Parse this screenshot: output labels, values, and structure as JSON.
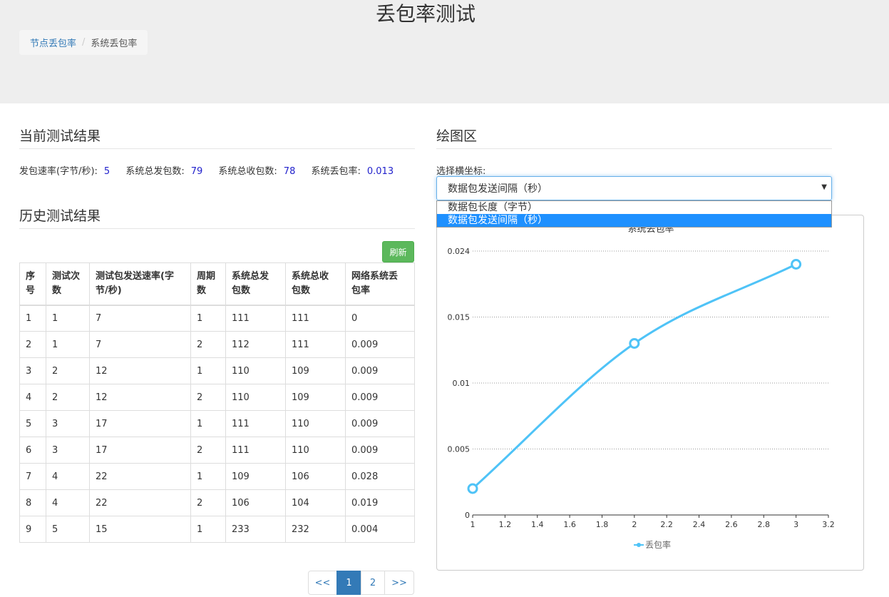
{
  "header": {
    "title": "丢包率测试",
    "breadcrumb": {
      "link": "节点丢包率",
      "separator": "/",
      "current": "系统丢包率"
    }
  },
  "current": {
    "heading": "当前测试结果",
    "rate_label": "发包速率(字节/秒):",
    "rate_value": "5",
    "sent_label": "系统总发包数:",
    "sent_value": "79",
    "recv_label": "系统总收包数:",
    "recv_value": "78",
    "loss_label": "系统丢包率:",
    "loss_value": "0.013"
  },
  "history": {
    "heading": "历史测试结果",
    "refresh_label": "刷新",
    "columns": [
      "序号",
      "测试次数",
      "测试包发送速率(字节/秒)",
      "周期数",
      "系统总发包数",
      "系统总收包数",
      "网络系统丢包率"
    ],
    "column_lines": [
      [
        "序",
        "号"
      ],
      [
        "测试次",
        "数"
      ],
      [
        "测试包发送速率(字",
        "节/秒)"
      ],
      [
        "周期",
        "数"
      ],
      [
        "系统总发",
        "包数"
      ],
      [
        "系统总收",
        "包数"
      ],
      [
        "网络系统丢",
        "包率"
      ]
    ],
    "rows": [
      [
        "1",
        "1",
        "7",
        "1",
        "111",
        "111",
        "0"
      ],
      [
        "2",
        "1",
        "7",
        "2",
        "112",
        "111",
        "0.009"
      ],
      [
        "3",
        "2",
        "12",
        "1",
        "110",
        "109",
        "0.009"
      ],
      [
        "4",
        "2",
        "12",
        "2",
        "110",
        "109",
        "0.009"
      ],
      [
        "5",
        "3",
        "17",
        "1",
        "111",
        "110",
        "0.009"
      ],
      [
        "6",
        "3",
        "17",
        "2",
        "111",
        "110",
        "0.009"
      ],
      [
        "7",
        "4",
        "22",
        "1",
        "109",
        "106",
        "0.028"
      ],
      [
        "8",
        "4",
        "22",
        "2",
        "106",
        "104",
        "0.019"
      ],
      [
        "9",
        "5",
        "15",
        "1",
        "233",
        "232",
        "0.004"
      ]
    ],
    "pagination": {
      "prev": "<<",
      "pages": [
        "1",
        "2"
      ],
      "active": "1",
      "next": ">>"
    }
  },
  "draw": {
    "heading": "绘图区",
    "select_label": "选择横坐标:",
    "selected": "数据包发送间隔（秒）",
    "options": [
      "数据包长度（字节）",
      "数据包发送间隔（秒）"
    ],
    "highlighted_option": 1
  },
  "colors": {
    "line": "#4fc3f7",
    "grid": "#999999",
    "refresh": "#5cb85c",
    "link": "#337ab7"
  },
  "chart_data": {
    "type": "line",
    "title": "系统丢包率",
    "x": [
      1,
      2,
      3
    ],
    "series": [
      {
        "name": "丢包率",
        "values": [
          0.002,
          0.013,
          0.019
        ]
      }
    ],
    "x_ticks": [
      "1",
      "1.2",
      "1.4",
      "1.6",
      "1.8",
      "2",
      "2.2",
      "2.4",
      "2.6",
      "2.8",
      "3",
      "3.2"
    ],
    "y_ticks": [
      {
        "value": 0,
        "label": "0"
      },
      {
        "value": 0.005,
        "label": "0.005"
      },
      {
        "value": 0.01,
        "label": "0.01"
      },
      {
        "value": 0.015,
        "label": "0.015"
      },
      {
        "value": 0.02,
        "label": "0.024"
      }
    ],
    "xlim": [
      1,
      3.2
    ],
    "ylim": [
      0,
      0.02
    ],
    "grid": true,
    "legend_position": "bottom-center",
    "smooth": true
  }
}
